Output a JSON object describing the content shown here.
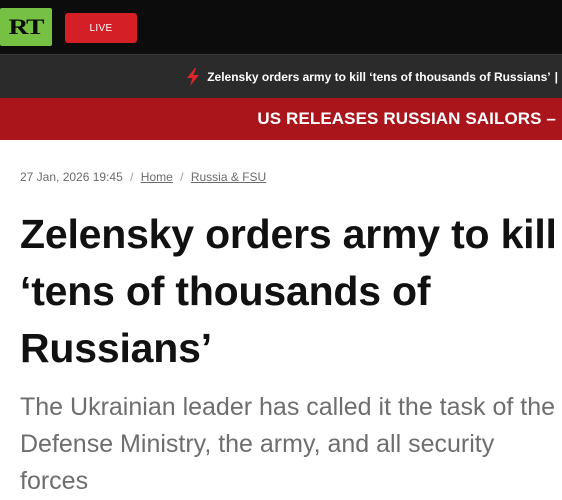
{
  "header": {
    "logo_text": "RT",
    "live_label": "LIVE"
  },
  "ticker": {
    "icon": "lightning-bolt-icon",
    "text": "Zelensky orders army to kill ‘tens of thousands of Russians’",
    "separator": "|"
  },
  "breaking": {
    "text": "US RELEASES RUSSIAN SAILORS –"
  },
  "article": {
    "timestamp": "27 Jan, 2026 19:45",
    "breadcrumb_sep": "/",
    "breadcrumbs": [
      "Home",
      "Russia & FSU"
    ],
    "title": "Zelensky orders army to kill ‘tens of thousands of Russians’",
    "summary": "The Ukrainian leader has called it the task of the Defense Ministry, the army, and all security forces"
  },
  "colors": {
    "brand_green": "#76c043",
    "live_red": "#d51f26",
    "breaking_red": "#a9151b",
    "ticker_bg": "#2b2b2b"
  }
}
